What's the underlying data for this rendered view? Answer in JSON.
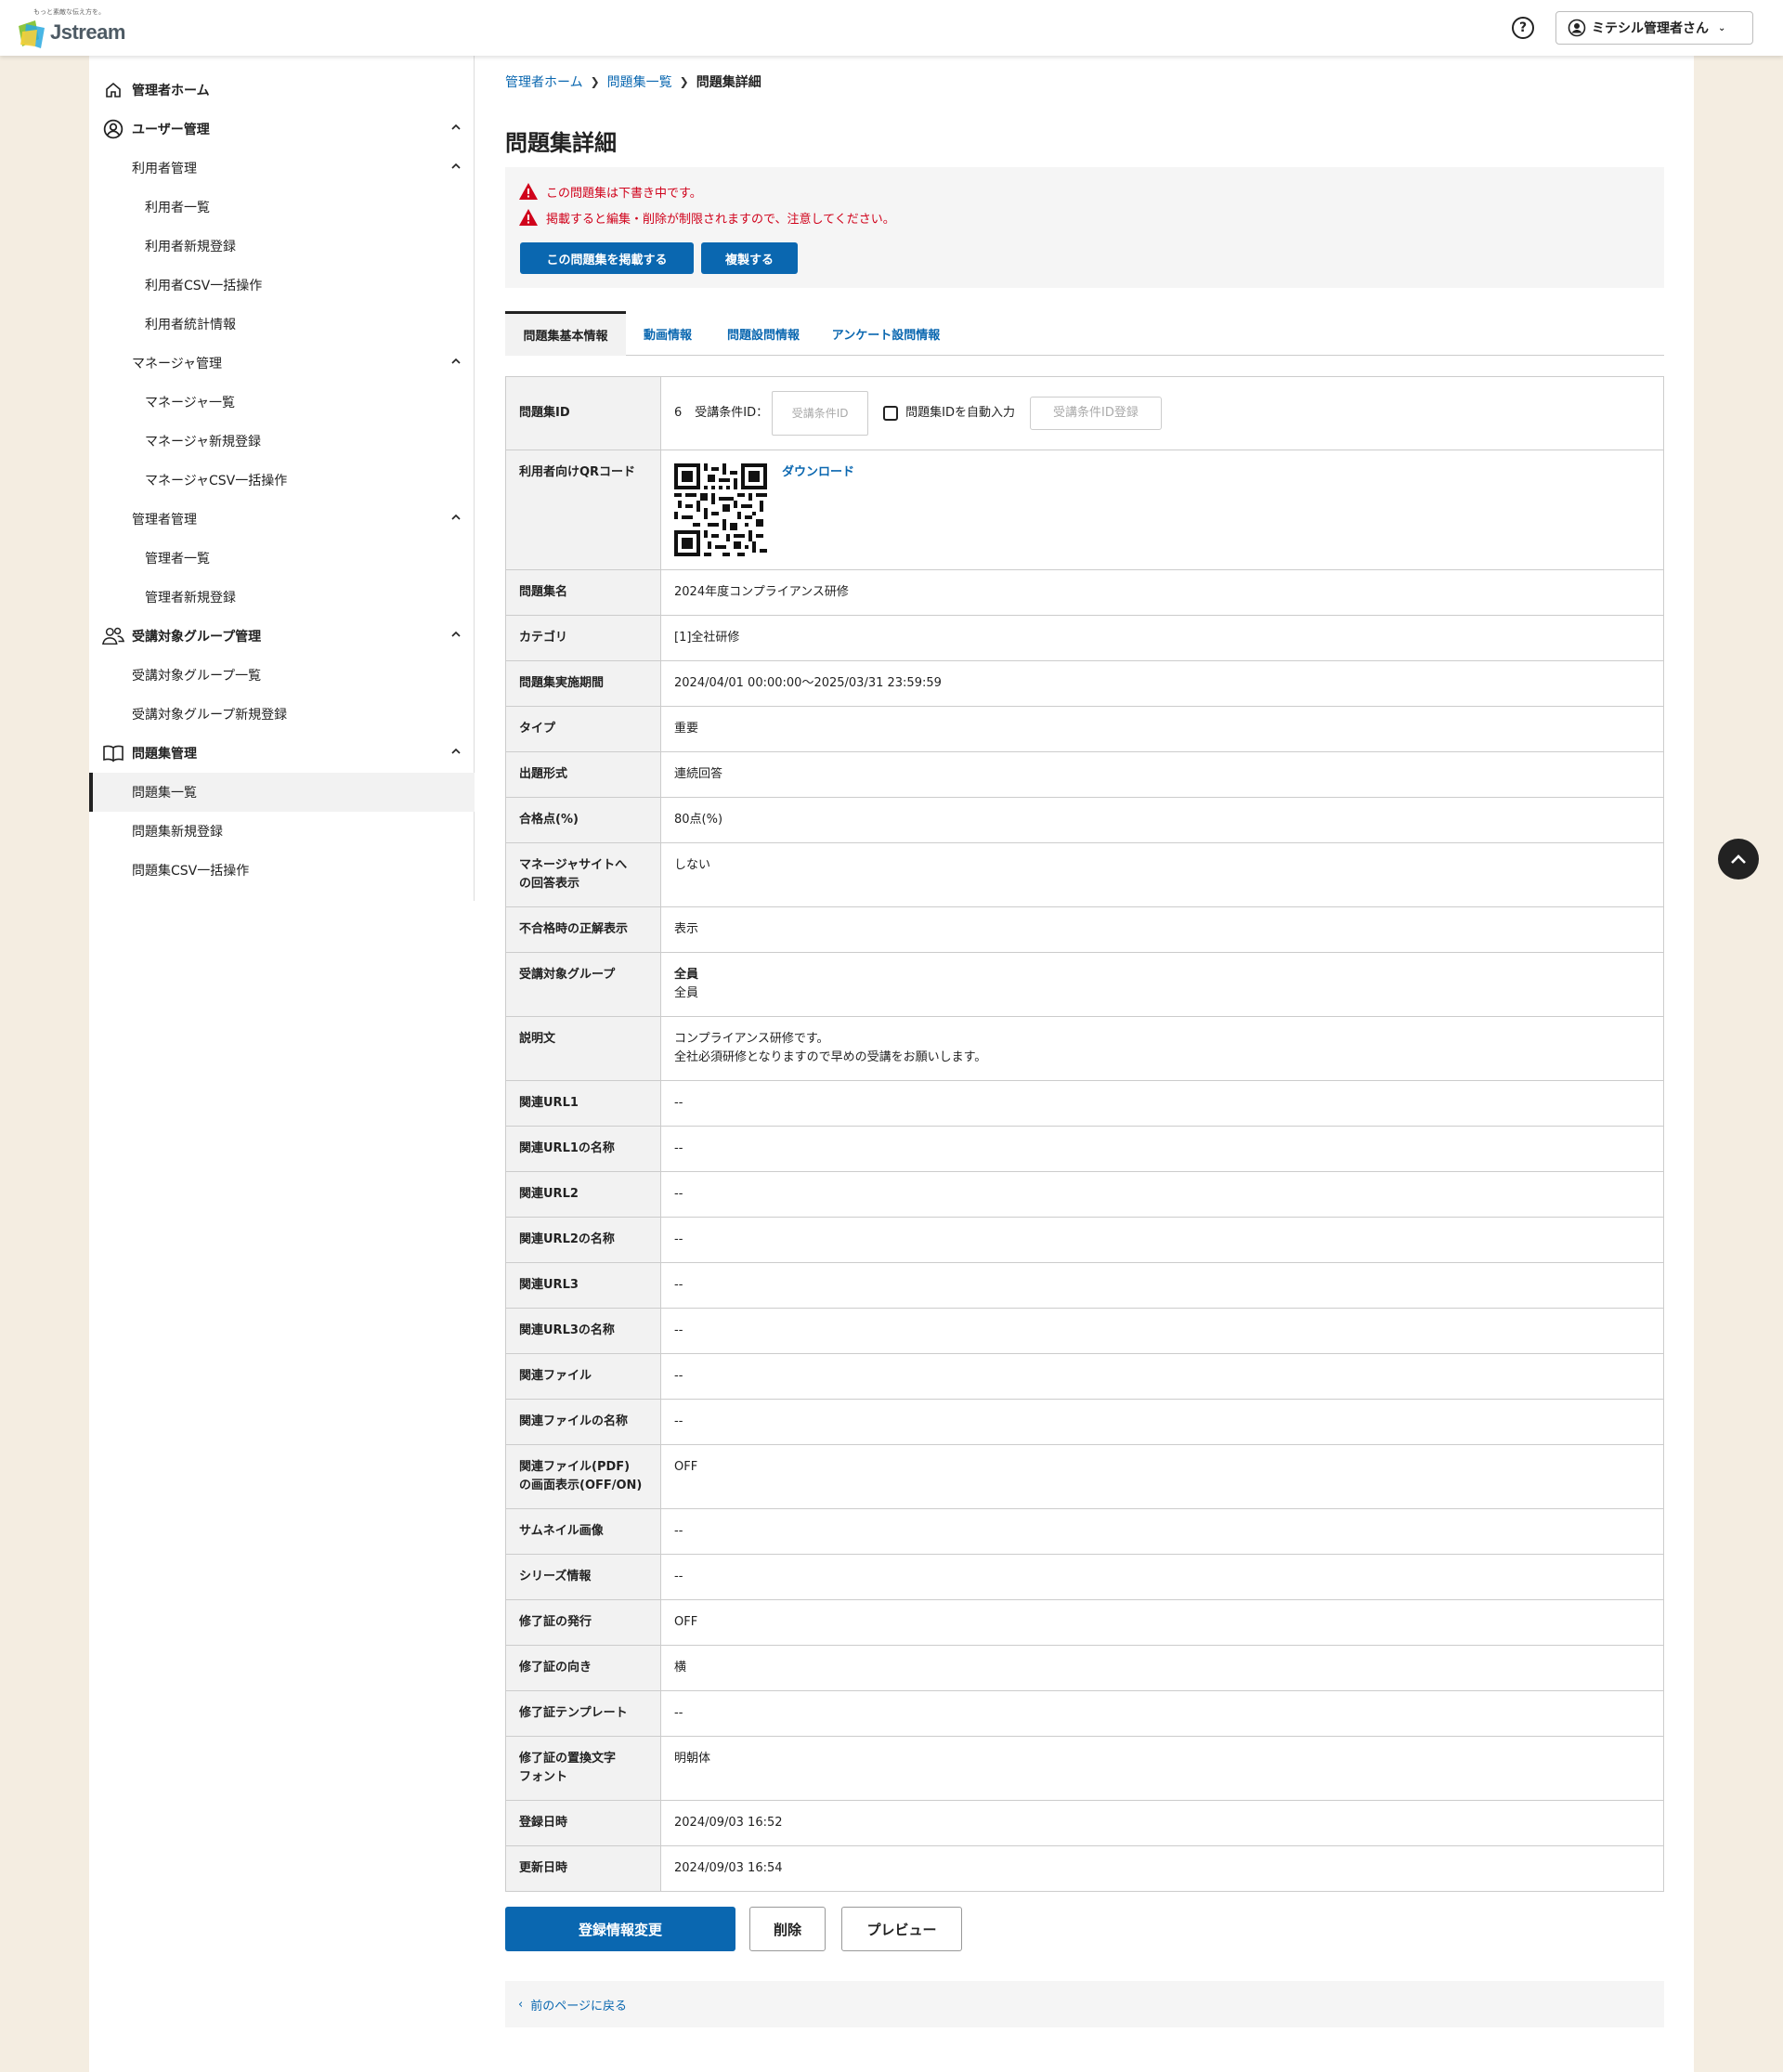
{
  "header": {
    "logo_tagline": "もっと素敵な伝え方を。",
    "logo_text": "Jstream",
    "help_icon": "question-circle-icon",
    "user_label": "ミテシル管理者さん",
    "user_icon": "user-circle-icon"
  },
  "sidebar": {
    "items": [
      {
        "label": "管理者ホーム",
        "level": 1,
        "icon": "home-icon"
      },
      {
        "label": "ユーザー管理",
        "level": 1,
        "icon": "user-circle-icon",
        "expanded": true
      },
      {
        "label": "利用者管理",
        "level": 2,
        "expanded": true
      },
      {
        "label": "利用者一覧",
        "level": 3
      },
      {
        "label": "利用者新規登録",
        "level": 3
      },
      {
        "label": "利用者CSV一括操作",
        "level": 3
      },
      {
        "label": "利用者統計情報",
        "level": 3
      },
      {
        "label": "マネージャ管理",
        "level": 2,
        "expanded": true
      },
      {
        "label": "マネージャ一覧",
        "level": 3
      },
      {
        "label": "マネージャ新規登録",
        "level": 3
      },
      {
        "label": "マネージャCSV一括操作",
        "level": 3
      },
      {
        "label": "管理者管理",
        "level": 2,
        "expanded": true
      },
      {
        "label": "管理者一覧",
        "level": 3
      },
      {
        "label": "管理者新規登録",
        "level": 3
      },
      {
        "label": "受講対象グループ管理",
        "level": 1,
        "icon": "users-icon",
        "expanded": true
      },
      {
        "label": "受講対象グループ一覧",
        "level": 2
      },
      {
        "label": "受講対象グループ新規登録",
        "level": 2
      },
      {
        "label": "問題集管理",
        "level": 1,
        "icon": "book-icon",
        "expanded": true
      },
      {
        "label": "問題集一覧",
        "level": 2,
        "active": true
      },
      {
        "label": "問題集新規登録",
        "level": 2
      },
      {
        "label": "問題集CSV一括操作",
        "level": 2
      }
    ]
  },
  "breadcrumb": {
    "home": "管理者ホーム",
    "list": "問題集一覧",
    "current": "問題集詳細"
  },
  "page_title": "問題集詳細",
  "notice": {
    "warning1": "この問題集は下書き中です。",
    "warning2": "掲載すると編集・削除が制限されますので、注意してください。",
    "publish_button": "この問題集を掲載する",
    "copy_button": "複製する"
  },
  "tabs": [
    "問題集基本情報",
    "動画情報",
    "問題設問情報",
    "アンケート設問情報"
  ],
  "id_row": {
    "label": "問題集ID",
    "id_value": "6",
    "condition_label": "受講条件ID：",
    "condition_placeholder": "受講条件ID",
    "auto_checkbox_label": "問題集IDを自動入力",
    "register_button": "受講条件ID登録"
  },
  "qr_row": {
    "label": "利用者向けQRコード",
    "download_link": "ダウンロード"
  },
  "details": [
    {
      "label": "問題集名",
      "value": "2024年度コンプライアンス研修"
    },
    {
      "label": "カテゴリ",
      "value": "[1]全社研修"
    },
    {
      "label": "問題集実施期間",
      "value": "2024/04/01 00:00:00～2025/03/31 23:59:59"
    },
    {
      "label": "タイプ",
      "value": "重要"
    },
    {
      "label": "出題形式",
      "value": "連続回答"
    },
    {
      "label": "合格点(%)",
      "value": "80点(%)"
    },
    {
      "label": "マネージャサイトへ\nの回答表示",
      "value": "しない"
    },
    {
      "label": "不合格時の正解表示",
      "value": "表示"
    },
    {
      "label": "受講対象グループ",
      "value_bold": "全員",
      "value": "全員"
    },
    {
      "label": "説明文",
      "value": "コンプライアンス研修です。\n全社必須研修となりますので早めの受講をお願いします。"
    },
    {
      "label": "関連URL1",
      "value": "--"
    },
    {
      "label": "関連URL1の名称",
      "value": "--"
    },
    {
      "label": "関連URL2",
      "value": "--"
    },
    {
      "label": "関連URL2の名称",
      "value": "--"
    },
    {
      "label": "関連URL3",
      "value": "--"
    },
    {
      "label": "関連URL3の名称",
      "value": "--"
    },
    {
      "label": "関連ファイル",
      "value": "--"
    },
    {
      "label": "関連ファイルの名称",
      "value": "--"
    },
    {
      "label": "関連ファイル(PDF)\nの画面表示(OFF/ON)",
      "value": "OFF"
    },
    {
      "label": "サムネイル画像",
      "value": "--"
    },
    {
      "label": "シリーズ情報",
      "value": "--"
    },
    {
      "label": "修了証の発行",
      "value": "OFF"
    },
    {
      "label": "修了証の向き",
      "value": "横"
    },
    {
      "label": "修了証テンプレート",
      "value": "--"
    },
    {
      "label": "修了証の置換文字\nフォント",
      "value": "明朝体"
    },
    {
      "label": "登録日時",
      "value": "2024/09/03 16:52"
    },
    {
      "label": "更新日時",
      "value": "2024/09/03 16:54"
    }
  ],
  "actions": {
    "edit": "登録情報変更",
    "delete": "削除",
    "preview": "プレビュー"
  },
  "back_link": "前のページに戻る",
  "colors": {
    "accent": "#0a67b0",
    "warning": "#d0021b",
    "page_bg": "#f4ede1"
  }
}
